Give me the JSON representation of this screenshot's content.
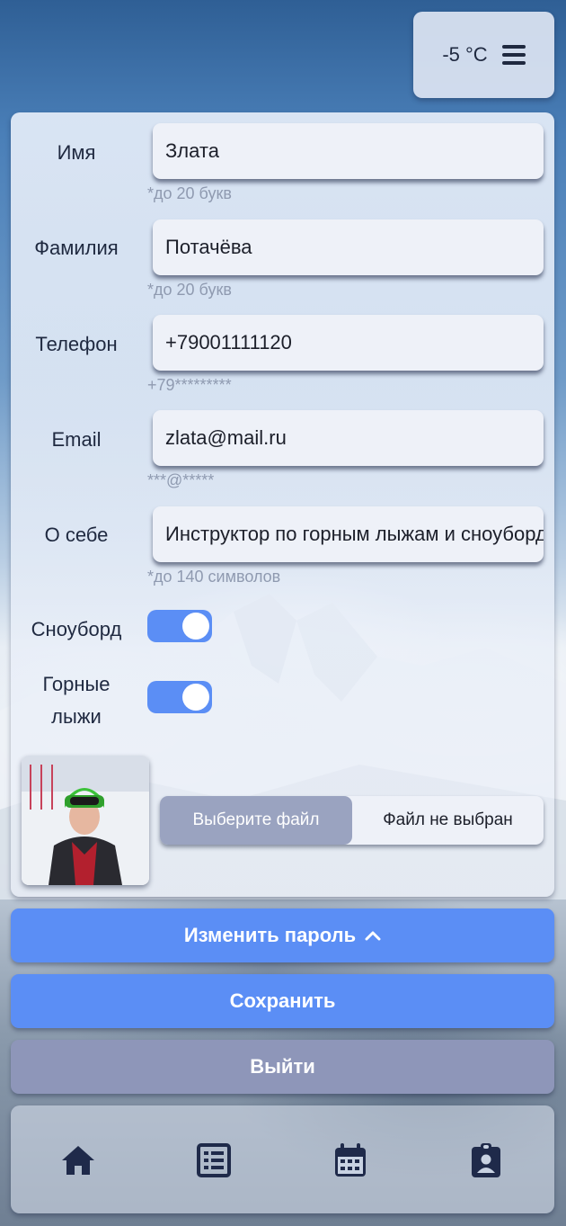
{
  "weather": {
    "temperature": "-5 °C",
    "menu_icon": "menu-icon"
  },
  "form": {
    "first_name": {
      "label": "Имя",
      "value": "Злата",
      "hint": "*до 20 букв"
    },
    "last_name": {
      "label": "Фамилия",
      "value": "Потачёва",
      "hint": "*до 20 букв"
    },
    "phone": {
      "label": "Телефон",
      "value": "+79001111120",
      "hint": "+79*********"
    },
    "email": {
      "label": "Email",
      "value": "zlata@mail.ru",
      "hint": "***@*****"
    },
    "about": {
      "label": "О себе",
      "value": "Инструктор по горным лыжам и сноуборду",
      "hint": "*до 140 символов"
    },
    "snowboard": {
      "label": "Сноуборд",
      "checked": true
    },
    "ski": {
      "label_line1": "Горные",
      "label_line2": "лыжи",
      "checked": true
    },
    "file": {
      "button_label": "Выберите файл",
      "status": "Файл не выбран"
    }
  },
  "actions": {
    "change_password": "Изменить пароль",
    "save": "Сохранить",
    "logout": "Выйти"
  },
  "nav": {
    "items": [
      {
        "icon": "home-icon",
        "active": true
      },
      {
        "icon": "list-icon",
        "active": false
      },
      {
        "icon": "calendar-icon",
        "active": false
      },
      {
        "icon": "profile-badge-icon",
        "active": false
      }
    ]
  },
  "colors": {
    "accent": "#5b8ef5",
    "muted_button": "#8e96b9",
    "text_dark": "#1f2940",
    "hint": "#8f9ab0"
  }
}
